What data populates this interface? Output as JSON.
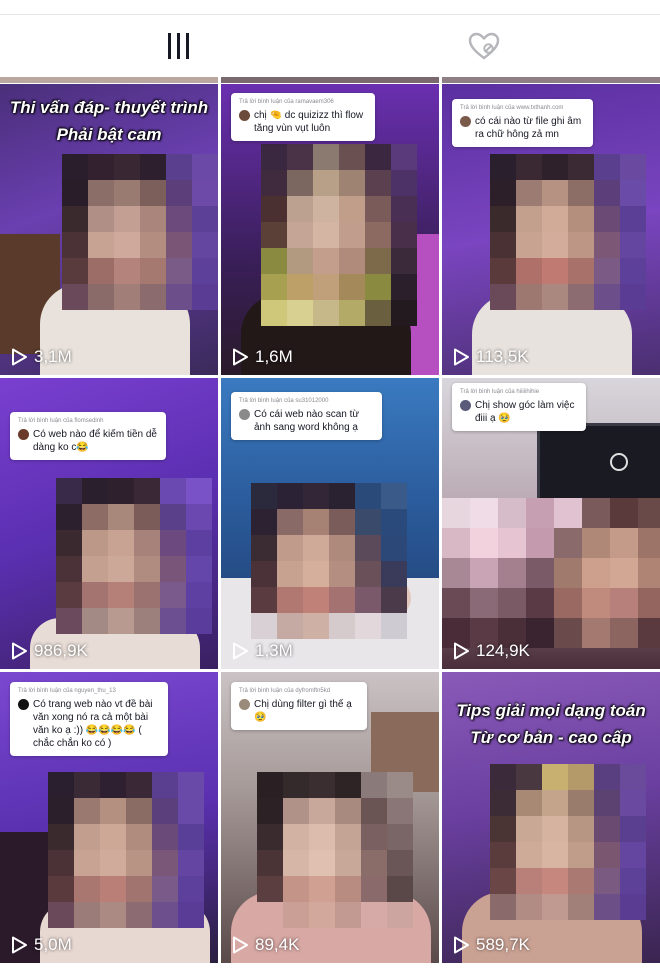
{
  "tabs": [
    {
      "label": "Videos",
      "icon": "grid-icon"
    },
    {
      "label": "Liked",
      "icon": "hidden-heart-icon"
    }
  ],
  "colors": {
    "text": "#161823",
    "border": "#e6e6e6",
    "bubble_muted": "#8a8b91"
  },
  "videos": [
    {
      "views": "3,1M",
      "caption_lines": [
        "Thi vấn đáp- thuyết trình",
        "Phải bật cam"
      ]
    },
    {
      "views": "1,6M",
      "reply_to": "Trả lời bình luận của ramavaem306",
      "comment": "chị 🤏 dc quizizz thì flow tăng vùn vụt luôn"
    },
    {
      "views": "113,5K",
      "reply_to": "Trả lời bình luận của www.txthanh.com",
      "comment": "có cái nào từ file ghi âm ra chữ hông zả mn"
    },
    {
      "views": "986,9K",
      "reply_to": "Trả lời bình luận của flomsedinh",
      "comment": "Có web nào để kiếm tiền dễ dàng ko c😂"
    },
    {
      "views": "1,3M",
      "reply_to": "Trả lời bình luận của su31012000",
      "comment": "Có cái web nào scan từ ảnh sang word không ạ"
    },
    {
      "views": "124,9K",
      "reply_to": "Trả lời bình luận của hiiiiihihie",
      "comment": "Chị show góc làm việc điii ạ 🥹"
    },
    {
      "views": "5,0M",
      "reply_to": "Trả lời bình luận của nguyen_thu_13",
      "comment": "Có trang web nào vt đề bài văn xong nó ra cả một bài văn ko ạ :)) 😂😂😂😂 ( chắc chắn ko có )"
    },
    {
      "views": "89,4K",
      "reply_to": "Trả lời bình luận của dyfromftn5kd",
      "comment": "Chị dùng filter gì thế ạ 🥹"
    },
    {
      "views": "589,7K",
      "caption_lines": [
        "Tips giải mọi dạng toán",
        "Từ cơ bản - cao cấp"
      ]
    }
  ]
}
